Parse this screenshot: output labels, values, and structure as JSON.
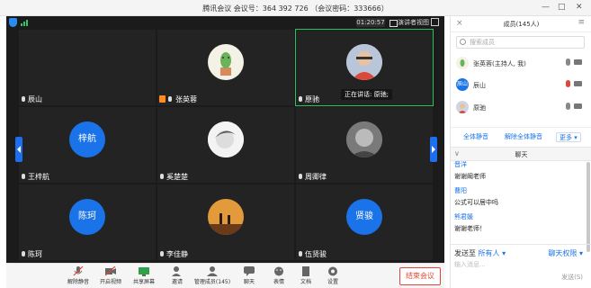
{
  "window": {
    "title": "腾讯会议 会议号：364 392 726 （会议密码：333666）",
    "min_icon": "minimize-icon",
    "max_icon": "maximize-icon",
    "close_icon": "close-icon"
  },
  "video_top": {
    "timer": "01:20:57",
    "speaker_view": "演讲者视图"
  },
  "tiles": [
    {
      "name": "辰山",
      "kind": "blank"
    },
    {
      "name": "张英蓉",
      "kind": "photo",
      "host": true
    },
    {
      "name": "原驰",
      "kind": "photo",
      "active": true,
      "speaking": "正在讲话: 原驰;"
    },
    {
      "name": "王梓航",
      "kind": "initial",
      "initial": "梓航"
    },
    {
      "name": "奚楚楚",
      "kind": "photo"
    },
    {
      "name": "周卿律",
      "kind": "photo"
    },
    {
      "name": "陈珂",
      "kind": "initial",
      "initial": "陈珂"
    },
    {
      "name": "李佳静",
      "kind": "photo"
    },
    {
      "name": "伍贤骏",
      "kind": "initial",
      "initial": "贤骏"
    }
  ],
  "toolbar": {
    "buttons": [
      {
        "label": "解除静音",
        "icon": "microphone-muted-icon"
      },
      {
        "label": "开启视频",
        "icon": "camera-off-icon"
      },
      {
        "label": "共享屏幕",
        "icon": "share-screen-icon"
      },
      {
        "label": "邀请",
        "icon": "invite-icon"
      },
      {
        "label": "管理成员(145)",
        "icon": "members-icon"
      },
      {
        "label": "聊天",
        "icon": "chat-icon"
      },
      {
        "label": "表情",
        "icon": "emoji-icon"
      },
      {
        "label": "文档",
        "icon": "document-icon"
      },
      {
        "label": "设置",
        "icon": "settings-icon"
      }
    ],
    "end_meeting": "结束会议"
  },
  "members_panel": {
    "title": "成员(145人)",
    "search_placeholder": "搜索成员",
    "members": [
      {
        "name": "张英蓉(主持人, 我)",
        "avatar": "photo"
      },
      {
        "name": "辰山",
        "avatar": "initial",
        "initial": "辰山"
      },
      {
        "name": "原驰",
        "avatar": "photo"
      }
    ],
    "mute_all": "全体静音",
    "unmute_all": "解除全体静音",
    "more": "更多 ▾"
  },
  "chat": {
    "title": "聊天",
    "messages": [
      {
        "sender": "晋洋",
        "text": "谢谢阚老师"
      },
      {
        "sender": "曹阳",
        "text": "公式可以居中吗"
      },
      {
        "sender": "熊君媛",
        "text": "谢谢老师！"
      }
    ],
    "send_to_label": "发送至",
    "send_to_value": "所有人 ▾",
    "permission": "聊天权限 ▾",
    "input_placeholder": "输入消息...",
    "send": "发送(S)"
  },
  "colors": {
    "accent": "#1a73e8",
    "danger": "#e2463b",
    "active_outline": "#2fbf5c"
  }
}
